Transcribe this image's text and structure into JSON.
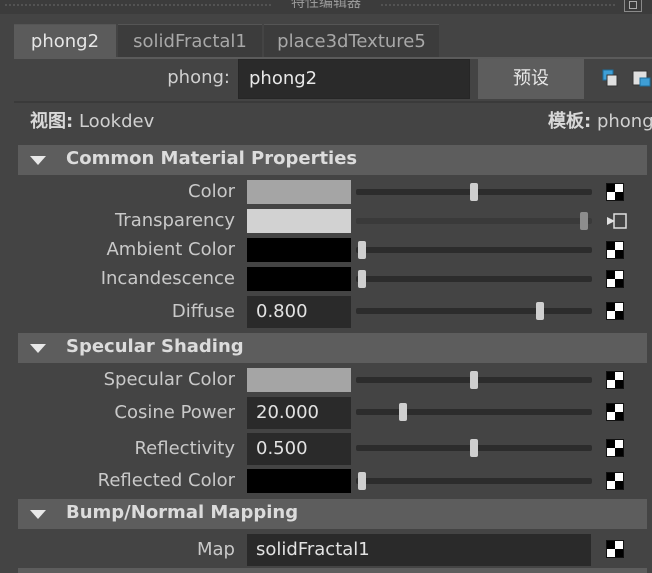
{
  "window": {
    "title": "特性编辑器"
  },
  "tabs": [
    {
      "label": "phong2",
      "active": true
    },
    {
      "label": "solidFractal1",
      "active": false
    },
    {
      "label": "place3dTexture5",
      "active": false
    }
  ],
  "node": {
    "type_label": "phong:",
    "name_value": "phong2",
    "preset_button": "预设"
  },
  "view": {
    "label": "视图:",
    "value": "Lookdev",
    "template_label": "模板:",
    "template_value": "phong"
  },
  "sections": {
    "common": {
      "title": "Common Material Properties",
      "rows": [
        {
          "label": "Color",
          "swatch": "#a5a5a5",
          "slider": 0.5
        },
        {
          "label": "Transparency",
          "swatch": "#d2d2d2",
          "slider": 1.0
        },
        {
          "label": "Ambient Color",
          "swatch": "#000000",
          "slider": 0.0
        },
        {
          "label": "Incandescence",
          "swatch": "#000000",
          "slider": 0.0
        },
        {
          "label": "Diffuse",
          "value": "0.800",
          "slider": 0.8
        }
      ]
    },
    "specular": {
      "title": "Specular Shading",
      "rows": [
        {
          "label": "Specular Color",
          "swatch": "#a5a5a5",
          "slider": 0.5
        },
        {
          "label": "Cosine Power",
          "value": "20.000",
          "slider": 0.2
        },
        {
          "label": "Reflectivity",
          "value": "0.500",
          "slider": 0.5
        },
        {
          "label": "Reflected Color",
          "swatch": "#000000",
          "slider": 0.0
        }
      ]
    },
    "bump": {
      "title": "Bump/Normal Mapping",
      "rows": [
        {
          "label": "Map",
          "value": "solidFractal1"
        }
      ]
    }
  }
}
